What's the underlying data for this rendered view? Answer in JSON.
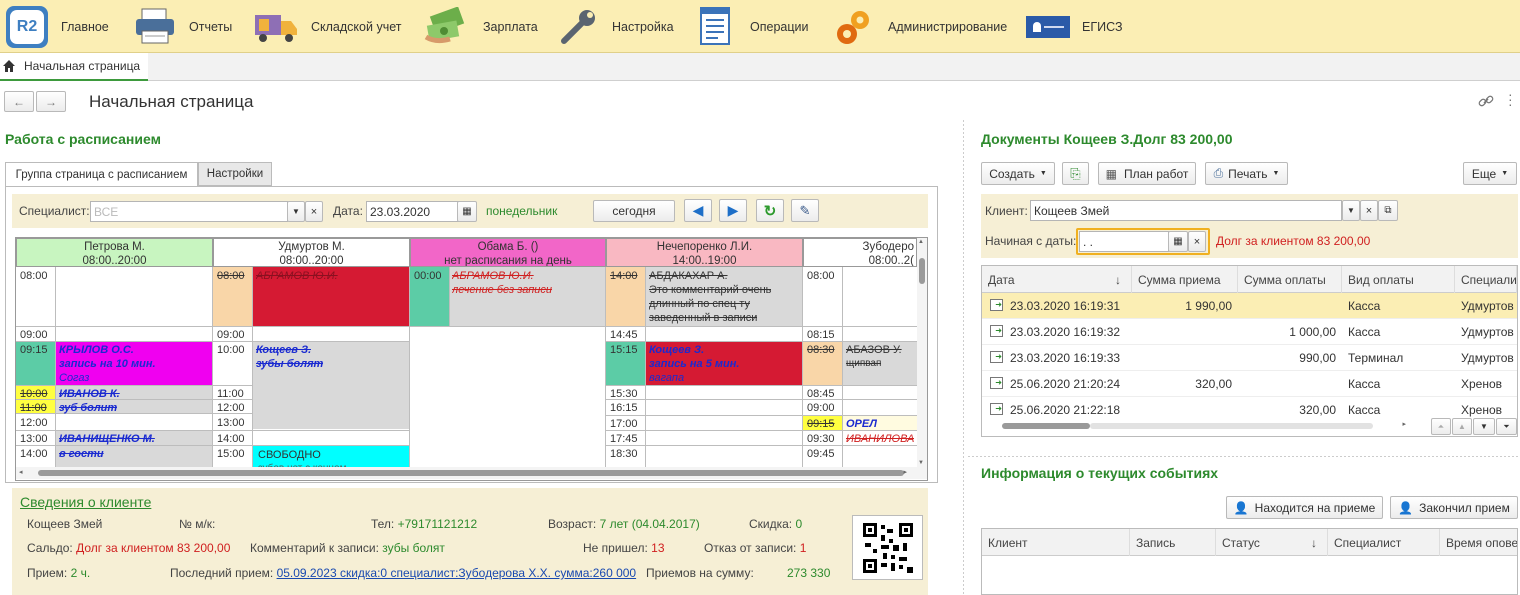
{
  "nav": [
    {
      "label": "Главное",
      "icon": "r2-logo-icon"
    },
    {
      "label": "Отчеты",
      "icon": "printer-icon"
    },
    {
      "label": "Складской учет",
      "icon": "truck-icon"
    },
    {
      "label": "Зарплата",
      "icon": "money-icon"
    },
    {
      "label": "Настройка",
      "icon": "wrench-icon"
    },
    {
      "label": "Операции",
      "icon": "document-list-icon"
    },
    {
      "label": "Администрирование",
      "icon": "gears-icon"
    },
    {
      "label": "ЕГИСЗ",
      "icon": "egisz-logo-icon"
    }
  ],
  "logo_text": "R2",
  "home_tab": "Начальная страница",
  "page_title": "Начальная страница",
  "schedule": {
    "title": "Работа с расписанием",
    "tabs": [
      "Группа страница с расписанием",
      "Настройки"
    ],
    "filter": {
      "specialist_label": "Специалист:",
      "specialist_placeholder": "ВСЕ",
      "date_label": "Дата:",
      "date": "23.03.2020",
      "weekday": "понедельник",
      "today": "сегодня"
    },
    "columns": [
      {
        "name": "Петрова М.",
        "hours": "08:00..20:00",
        "color": "#c8f5c0"
      },
      {
        "name": "Удмуртов М.",
        "hours": "08:00..20:00",
        "color": "#ffffff"
      },
      {
        "name": "Обама Б. ()",
        "hours": "нет расписания на день",
        "color": "#f266c8"
      },
      {
        "name": "Нечепоренко Л.И.",
        "hours": "14:00..19:00",
        "color": "#f9b8c2"
      },
      {
        "name": "Зубодеро",
        "hours": "08:00..2(",
        "color": "#ffffff"
      }
    ],
    "col0_times": [
      "08:00",
      "09:00",
      "09:15",
      "10:00",
      "11:00",
      "12:00",
      "13:00",
      "14:00"
    ],
    "col1_times": [
      "08:00",
      "09:00",
      "10:00",
      "11:00",
      "12:00",
      "13:00",
      "14:00",
      "15:00"
    ],
    "col3_times": [
      "14:00",
      "14:45",
      "15:15",
      "15:30",
      "16:15",
      "17:00",
      "17:45",
      "18:30"
    ],
    "col4_times": [
      "08:00",
      "08:15",
      "08:30",
      "08:45",
      "09:00",
      "09:15",
      "09:30",
      "09:45"
    ],
    "col2_time": "00:00",
    "appts": {
      "a1": "КРЫЛОВ О.С.",
      "a1b": " запись на 10 мин.",
      "a1c": "Согаз",
      "a2": "ИВАНОВ К.",
      "a2b": "зуб болит",
      "a3": "ИВАНИЩЕНКО М.",
      "a3b": "в гости",
      "b1": "АБРАМОВ Ю.И.",
      "b2": "Кощеев З.",
      "b2b": "зубы болят",
      "b3": "СВОБОДНО",
      "b3b": "зубов нет с концом",
      "c1": "АБРАМОВ Ю.И.",
      "c1b": " лечение без записи",
      "d1": "АБДАКАХАР А.",
      "d1b": "Это комментарий очень",
      "d1c": "длинный по спец ту",
      "d1d": "заведенный в записи",
      "d2": "Кощеев З.",
      "d2b": " запись на 5 мин.",
      "d2c": "вагапа",
      "e1": "АБАЗОВ У.",
      "e1b": "щипвап",
      "e2": "ОРЕЛ",
      "e3": "ИВАНИЛОВА"
    }
  },
  "client": {
    "title": "Сведения о клиенте",
    "name": "Кощеев Змей",
    "card_label": "№ м/к:",
    "phone_label": "Тел:",
    "phone": "+79171121212",
    "age_label": "Возраст:",
    "age": "7 лет  (04.04.2017)",
    "discount_label": "Скидка:",
    "discount": "0",
    "balance_label": "Сальдо:",
    "balance": "Долг за клиентом 83 200,00",
    "comment_label": "Комментарий к записи:",
    "comment": "зубы болят",
    "noshow_label": "Не пришел:",
    "noshow": "13",
    "refuse_label": "Отказ от записи:",
    "refuse": "1",
    "visit_label": "Прием:",
    "visit": "2 ч.",
    "last_label": "Последний прием:",
    "last": "05.09.2023 скидка:0 специалист:Зубодерова Х.Х. сумма:260 000",
    "sum_label": "Приемов на сумму:",
    "sum": "273 330"
  },
  "docs": {
    "title": "Документы Кощеев З.Долг 83 200,00",
    "create": "Создать",
    "plan": "План работ",
    "print": "Печать",
    "more": "Еще",
    "client_label": "Клиент:",
    "client_value": "Кощеев Змей",
    "start_label": "Начиная с даты:",
    "start_value": "  .  .",
    "debt": "Долг за клиентом 83 200,00",
    "headers": [
      "Дата",
      "Сумма приема",
      "Сумма оплаты",
      "Вид оплаты",
      "Специалис"
    ],
    "rows": [
      [
        "23.03.2020 16:19:31",
        "1 990,00",
        "",
        "Касса",
        "Удмуртов"
      ],
      [
        "23.03.2020 16:19:32",
        "",
        "1 000,00",
        "Касса",
        "Удмуртов"
      ],
      [
        "23.03.2020 16:19:33",
        "",
        "990,00",
        "Терминал",
        "Удмуртов"
      ],
      [
        "25.06.2020 21:20:24",
        "320,00",
        "",
        "Касса",
        "Хренов"
      ],
      [
        "25.06.2020 21:22:18",
        "",
        "320,00",
        "Касса",
        "Хренов"
      ]
    ]
  },
  "events": {
    "title": "Информация о текущих событиях",
    "btn1": "Находится на приеме",
    "btn2": "Закончил прием",
    "headers": [
      "Клиент",
      "Запись",
      "Статус",
      "Специалист",
      "Время опове"
    ]
  }
}
